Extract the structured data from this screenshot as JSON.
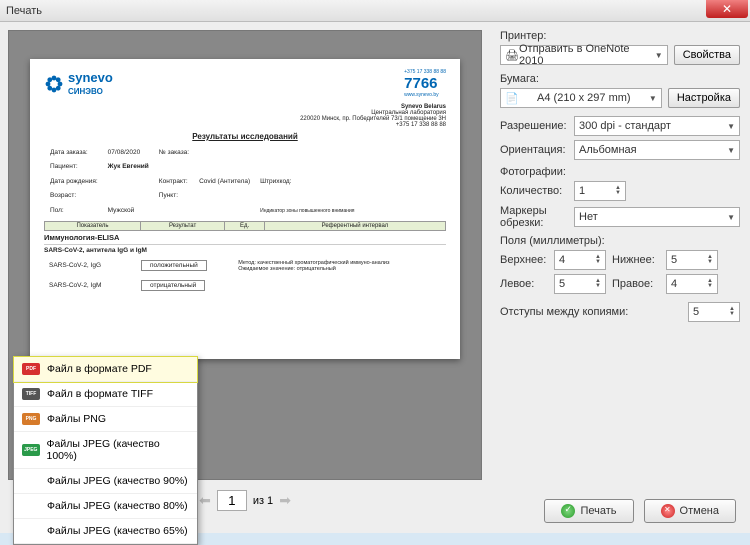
{
  "window": {
    "title": "Печать"
  },
  "printer": {
    "label": "Принтер:",
    "selected": "Отправить в OneNote 2010",
    "properties_btn": "Свойства"
  },
  "paper": {
    "label": "Бумага:",
    "selected": "A4 (210 x 297 mm)",
    "settings_btn": "Настройка",
    "resolution_label": "Разрешение:",
    "resolution": "300 dpi - стандарт",
    "orientation_label": "Ориентация:",
    "orientation": "Альбомная"
  },
  "photos": {
    "label": "Фотографии:",
    "count_label": "Количество:",
    "count": "1",
    "crop_label": "Маркеры обрезки:",
    "crop": "Нет"
  },
  "margins": {
    "label": "Поля (миллиметры):",
    "top_label": "Верхнее:",
    "top": "4",
    "bottom_label": "Нижнее:",
    "bottom": "5",
    "left_label": "Левое:",
    "left": "5",
    "right_label": "Правое:",
    "right": "4",
    "gap_label": "Отступы между копиями:",
    "gap": "5"
  },
  "pager": {
    "current": "1",
    "of": "из 1"
  },
  "buttons": {
    "print": "Печать",
    "cancel": "Отмена"
  },
  "export_menu": {
    "items": [
      {
        "label": "Файл в формате PDF",
        "icon": "pdf"
      },
      {
        "label": "Файл в формате TIFF",
        "icon": "tiff"
      },
      {
        "label": "Файлы PNG",
        "icon": "png"
      },
      {
        "label": "Файлы JPEG (качество 100%)",
        "icon": "jpeg"
      },
      {
        "label": "Файлы JPEG (качество 90%)",
        "icon": ""
      },
      {
        "label": "Файлы JPEG (качество 80%)",
        "icon": ""
      },
      {
        "label": "Файлы JPEG (качество 65%)",
        "icon": ""
      }
    ]
  },
  "document": {
    "brand": "synevo",
    "brand_sub": "СИНЭВО",
    "phone_small": "+375 17 338 88 88",
    "phone": "7766",
    "site": "www.synevo.by",
    "company": "Synevo Belarus",
    "lab": "Центральная лаборатория",
    "address": "220020 Минск, пр. Победителей 73/1 помещение 3Н",
    "tel": "+375 17 338 88 88",
    "title": "Результаты исследований",
    "order_date_l": "Дата заказа:",
    "order_date": "07/08/2020",
    "order_no_l": "№ заказа:",
    "patient_l": "Пациент:",
    "patient": "Жук Евгений",
    "dob_l": "Дата рождения:",
    "contract_l": "Контракт:",
    "contract": "Covid (Антитела)",
    "barcode_l": "Штрихкод:",
    "age_l": "Возраст:",
    "point_l": "Пункт:",
    "sex_l": "Пол:",
    "sex": "Мужской",
    "legend": "Индикатор зоны повышенного внимания",
    "th1": "Показатель",
    "th2": "Результат",
    "th3": "Ед.",
    "th4": "Референтный интервал",
    "section": "Иммунология-ELISA",
    "sub": "SARS-CoV-2, антитела IgG и IgM",
    "r1": "SARS-CoV-2, IgG",
    "r1v": "положительный",
    "r1m": "Метод: качественный хроматографический иммуно-анализ\nОжидаемое значение: отрицательный",
    "r2": "SARS-CoV-2, IgM",
    "r2v": "отрицательный"
  }
}
